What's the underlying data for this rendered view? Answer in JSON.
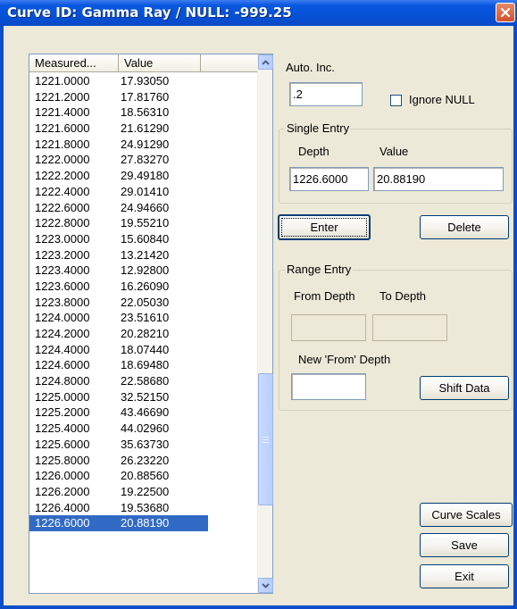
{
  "window": {
    "title": "Curve ID: Gamma Ray / NULL: -999.25"
  },
  "list": {
    "columns": [
      "Measured...",
      "Value"
    ],
    "rows": [
      {
        "depth": "1221.0000",
        "value": "17.93050"
      },
      {
        "depth": "1221.2000",
        "value": "17.81760"
      },
      {
        "depth": "1221.4000",
        "value": "18.56310"
      },
      {
        "depth": "1221.6000",
        "value": "21.61290"
      },
      {
        "depth": "1221.8000",
        "value": "24.91290"
      },
      {
        "depth": "1222.0000",
        "value": "27.83270"
      },
      {
        "depth": "1222.2000",
        "value": "29.49180"
      },
      {
        "depth": "1222.4000",
        "value": "29.01410"
      },
      {
        "depth": "1222.6000",
        "value": "24.94660"
      },
      {
        "depth": "1222.8000",
        "value": "19.55210"
      },
      {
        "depth": "1223.0000",
        "value": "15.60840"
      },
      {
        "depth": "1223.2000",
        "value": "13.21420"
      },
      {
        "depth": "1223.4000",
        "value": "12.92800"
      },
      {
        "depth": "1223.6000",
        "value": "16.26090"
      },
      {
        "depth": "1223.8000",
        "value": "22.05030"
      },
      {
        "depth": "1224.0000",
        "value": "23.51610"
      },
      {
        "depth": "1224.2000",
        "value": "20.28210"
      },
      {
        "depth": "1224.4000",
        "value": "18.07440"
      },
      {
        "depth": "1224.6000",
        "value": "18.69480"
      },
      {
        "depth": "1224.8000",
        "value": "22.58680"
      },
      {
        "depth": "1225.0000",
        "value": "32.52150"
      },
      {
        "depth": "1225.2000",
        "value": "43.46690"
      },
      {
        "depth": "1225.4000",
        "value": "44.02960"
      },
      {
        "depth": "1225.6000",
        "value": "35.63730"
      },
      {
        "depth": "1225.8000",
        "value": "26.23220"
      },
      {
        "depth": "1226.0000",
        "value": "20.88560"
      },
      {
        "depth": "1226.2000",
        "value": "19.22500"
      },
      {
        "depth": "1226.4000",
        "value": "19.53680"
      },
      {
        "depth": "1226.6000",
        "value": "20.88190",
        "selected": true
      }
    ]
  },
  "auto_inc": {
    "label": "Auto. Inc.",
    "value": ".2"
  },
  "ignore_null": {
    "label": "Ignore NULL",
    "checked": false
  },
  "single_entry": {
    "legend": "Single Entry",
    "depth_label": "Depth",
    "value_label": "Value",
    "depth_value": "1226.6000",
    "value_value": "20.88190"
  },
  "buttons": {
    "enter": "Enter",
    "delete": "Delete",
    "shift_data": "Shift Data",
    "curve_scales": "Curve Scales",
    "save": "Save",
    "exit": "Exit"
  },
  "range_entry": {
    "legend": "Range Entry",
    "from_depth_label": "From Depth",
    "to_depth_label": "To Depth",
    "new_from_depth_label": "New 'From' Depth",
    "from_depth_value": "",
    "to_depth_value": "",
    "new_from_depth_value": ""
  },
  "colors": {
    "titlebar": "#0551d6",
    "selection": "#316ac5",
    "window_bg": "#ece9d8"
  }
}
